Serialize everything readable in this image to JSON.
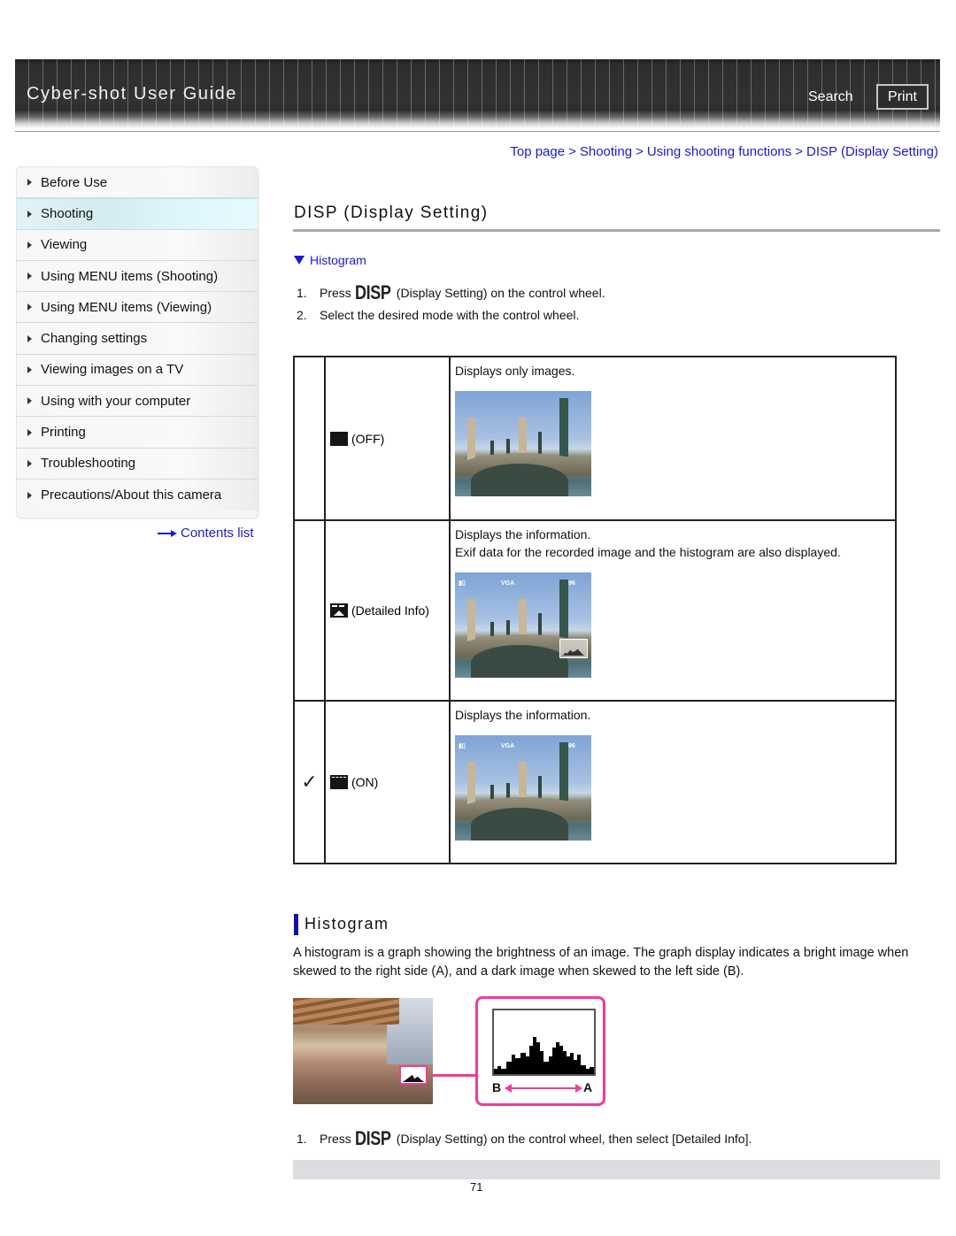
{
  "header": {
    "title": "Cyber-shot User Guide",
    "search_label": "Search",
    "print_label": "Print"
  },
  "breadcrumb": [
    {
      "label": "Top page"
    },
    {
      "label": "Shooting"
    },
    {
      "label": "Using shooting functions"
    },
    {
      "label": "DISP (Display Setting)"
    }
  ],
  "breadcrumb_separator": ">",
  "sidebar": {
    "items": [
      {
        "label": "Before Use",
        "active": false
      },
      {
        "label": "Shooting",
        "active": true
      },
      {
        "label": "Viewing",
        "active": false
      },
      {
        "label": "Using MENU items (Shooting)",
        "active": false
      },
      {
        "label": "Using MENU items (Viewing)",
        "active": false
      },
      {
        "label": "Changing settings",
        "active": false
      },
      {
        "label": "Viewing images on a TV",
        "active": false
      },
      {
        "label": "Using with your computer",
        "active": false
      },
      {
        "label": "Printing",
        "active": false
      },
      {
        "label": "Troubleshooting",
        "active": false
      },
      {
        "label": "Precautions/About this camera",
        "active": false
      }
    ],
    "contents_link": "Contents list"
  },
  "main": {
    "title": "DISP (Display Setting)",
    "anchor_link": "Histogram",
    "disp_glyph": "DISP",
    "steps": [
      {
        "num": "1.",
        "before": "Press",
        "after": "(Display Setting) on the control wheel."
      },
      {
        "num": "2.",
        "text": "Select the desired mode with the control wheel."
      }
    ],
    "modes": [
      {
        "default": false,
        "icon": "display-off-icon",
        "label": "(OFF)",
        "description_lines": [
          "Displays only images."
        ],
        "osd": null
      },
      {
        "default": false,
        "icon": "detailed-info-icon",
        "label": "(Detailed Info)",
        "description_lines": [
          "Displays the information.",
          "Exif data for the recorded image and the histogram are also displayed."
        ],
        "osd": {
          "count": "96",
          "size": "VGA"
        }
      },
      {
        "default": true,
        "icon": "display-on-icon",
        "label": "(ON)",
        "description_lines": [
          "Displays the information."
        ],
        "osd": {
          "count": "96",
          "size": "VGA"
        }
      }
    ],
    "default_mark": "✓"
  },
  "histogram_section": {
    "title": "Histogram",
    "body": "A histogram is a graph showing the brightness of an image. The graph display indicates a bright image when skewed to the right side (A), and a dark image when skewed to the left side (B).",
    "label_b": "B",
    "label_a": "A",
    "step": {
      "num": "1.",
      "before": "Press",
      "after": "(Display Setting) on the control wheel, then select [Detailed Info]."
    }
  },
  "footer": {
    "page_number": "71"
  },
  "colors": {
    "link": "#1a1ad0",
    "accent_bar": "#1212a0",
    "highlight_pink": "#ee3c9a",
    "active_nav": "#dff6fa"
  }
}
